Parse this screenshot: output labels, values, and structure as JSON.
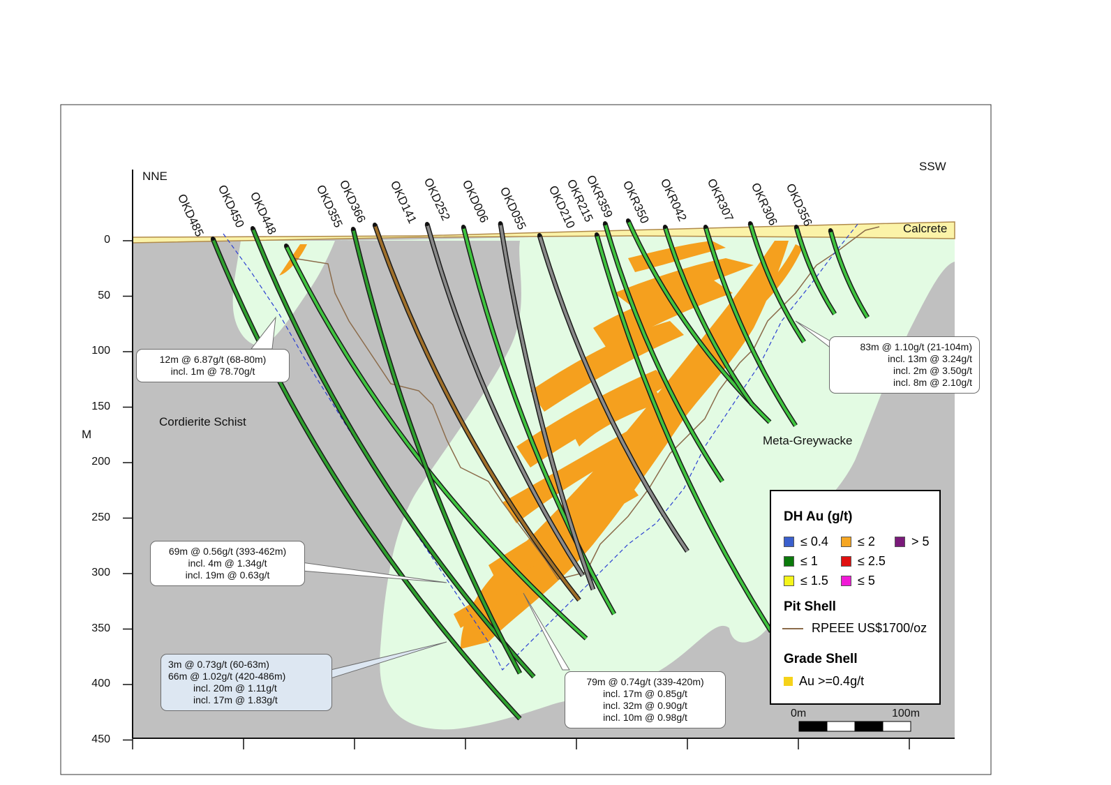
{
  "section": {
    "direction_left": "NNE",
    "direction_right": "SSW",
    "depth_unit": "M",
    "depth_ticks": [
      "0",
      "50",
      "100",
      "150",
      "200",
      "250",
      "300",
      "350",
      "400",
      "450"
    ],
    "units": {
      "calcrete": "Calcrete",
      "cordierite": "Cordierite Schist",
      "meta_greywacke": "Meta-Greywacke"
    },
    "holes": [
      "OKD485",
      "OKD450",
      "OKD448",
      "OKD355",
      "OKD366",
      "OKD141",
      "OKD252",
      "OKD006",
      "OKD055",
      "OKD210",
      "OKR215",
      "OKR359",
      "OKR350",
      "OKR042",
      "OKR307",
      "OKR306",
      "OKD356"
    ]
  },
  "callouts": {
    "c1": {
      "l1": "12m @ 6.87g/t (68-80m)",
      "l2": "incl. 1m @ 78.70g/t"
    },
    "c2": {
      "l1": "83m @ 1.10g/t (21-104m)",
      "l2": "incl. 13m @ 3.24g/t",
      "l3": "incl. 2m @ 3.50g/t",
      "l4": "incl. 8m @ 2.10g/t"
    },
    "c3": {
      "l1": "69m @ 0.56g/t (393-462m)",
      "l2": "incl. 4m @ 1.34g/t",
      "l3": "incl. 19m @ 0.63g/t"
    },
    "c4": {
      "l1": "3m @ 0.73g/t (60-63m)",
      "l2": "66m @ 1.02g/t (420-486m)",
      "l3": "incl. 20m @ 1.11g/t",
      "l4": "incl. 17m @ 1.83g/t"
    },
    "c5": {
      "l1": "79m @ 0.74g/t (339-420m)",
      "l2": "incl. 17m @ 0.85g/t",
      "l3": "incl. 32m @ 0.90g/t",
      "l4": "incl. 10m @ 0.98g/t"
    }
  },
  "legend": {
    "dh_title": "DH Au (g/t)",
    "grades": [
      {
        "label": "≤ 0.4",
        "color": "#3a5fcd"
      },
      {
        "label": "≤ 2",
        "color": "#f5a623"
      },
      {
        "label": "> 5",
        "color": "#7a1a7a"
      },
      {
        "label": "≤ 1",
        "color": "#0b7a0b"
      },
      {
        "label": "≤ 2.5",
        "color": "#e01010"
      },
      {
        "label": "≤ 1.5",
        "color": "#f5f51a"
      },
      {
        "label": "≤ 5",
        "color": "#f01ad6"
      }
    ],
    "pit_title": "Pit Shell",
    "pit_label": "RPEEE US$1700/oz",
    "grade_title": "Grade Shell",
    "grade_label": "Au >=0.4g/t",
    "grade_color": "#f5d21a",
    "scale_left": "0m",
    "scale_right": "100m"
  },
  "colors": {
    "schist": "#c0c0c0",
    "greywacke": "#e3fbe3",
    "calcrete": "#fbf3a8",
    "orebody": "#f5a01e",
    "hole_green": "#3fc43f"
  }
}
